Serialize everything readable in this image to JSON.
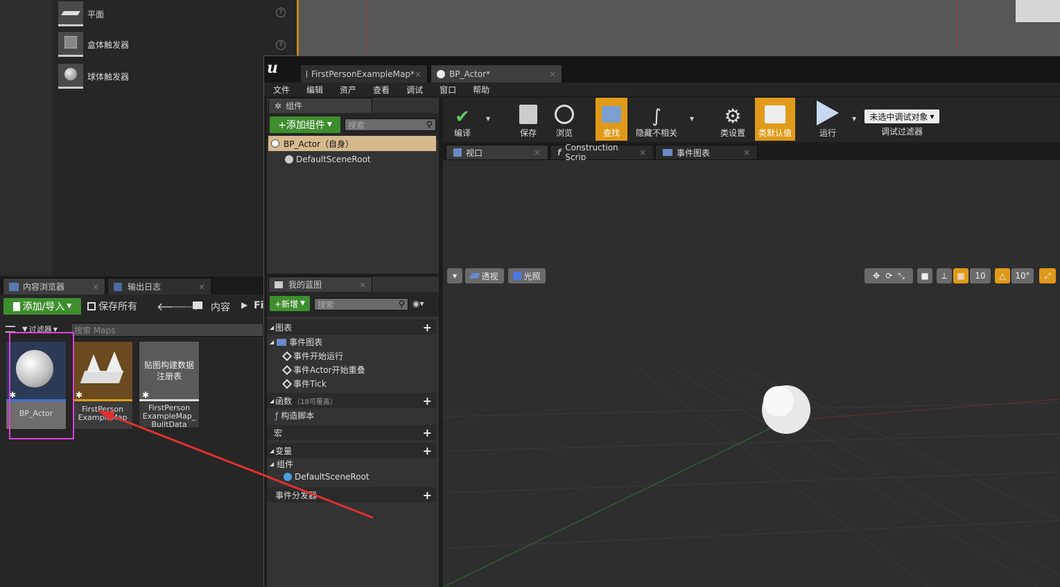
{
  "place_items": [
    {
      "label": "平面"
    },
    {
      "label": "盒体触发器"
    },
    {
      "label": "球体触发器"
    }
  ],
  "content_browser": {
    "tabs": [
      "内容浏览器",
      "输出日志"
    ],
    "add_import": "添加/导入",
    "save_all": "保存所有",
    "path_root": "内容",
    "path_next": "Fi",
    "filter_label": "过滤器",
    "search_placeholder": "搜索 Maps",
    "assets": [
      {
        "name": "BP_Actor"
      },
      {
        "name": "FirstPerson ExampleMap"
      },
      {
        "name": "FirstPerson ExampleMap_ BuiltData",
        "thumb_text": "贴图构建数据注册表"
      }
    ]
  },
  "bp_editor": {
    "tabs": [
      "FirstPersonExampleMap*",
      "BP_Actor*"
    ],
    "menu": [
      "文件",
      "编辑",
      "资产",
      "查看",
      "调试",
      "窗口",
      "帮助"
    ],
    "components_tab": "组件",
    "add_component": "+添加组件",
    "search_placeholder": "搜索",
    "root_item": "BP_Actor（自身）",
    "scene_root": "DefaultSceneRoot",
    "myblueprint_tab": "我的蓝图",
    "new_button": "+新增",
    "sections": {
      "graphs": "图表",
      "event_graph": "事件图表",
      "begin_play": "事件开始运行",
      "actor_overlap": "事件Actor开始重叠",
      "tick": "事件Tick",
      "functions": "函数",
      "functions_count": "（18可覆盖）",
      "construction": "构造脚本",
      "macros": "宏",
      "variables": "变量",
      "components": "组件",
      "comp_root": "DefaultSceneRoot",
      "dispatchers": "事件分发器"
    },
    "toolbar": [
      {
        "label": "编译"
      },
      {
        "label": "保存"
      },
      {
        "label": "浏览"
      },
      {
        "label": "查找"
      },
      {
        "label": "隐藏不相关"
      },
      {
        "label": "类设置"
      },
      {
        "label": "类默认值"
      },
      {
        "label": "运行"
      }
    ],
    "debug_select": "未选中调试对象",
    "debug_filter": "调试过滤器",
    "view_tabs": [
      "视口",
      "Construction Scrip",
      "事件图表"
    ],
    "viewport": {
      "perspective": "透视",
      "lit": "光照",
      "grid_snap": "10",
      "rot_snap": "10°"
    }
  },
  "colors": {
    "highlight": "#e040e0",
    "accent_orange": "#e09a1a",
    "green": "#3e8e2e",
    "arrow": "#e03030"
  }
}
